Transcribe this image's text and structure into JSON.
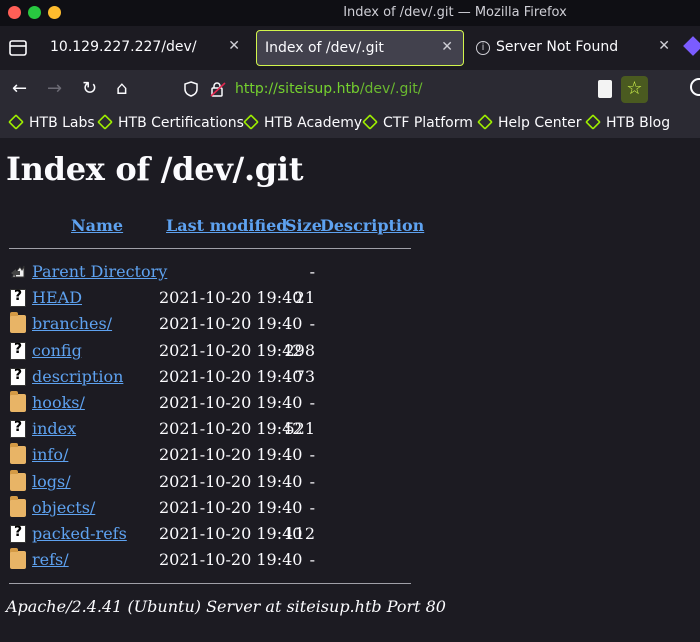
{
  "window": {
    "title": "Index of /dev/.git — Mozilla Firefox"
  },
  "tabs": [
    {
      "label": "10.129.227.227/dev/",
      "close": "✕"
    },
    {
      "label": "Index of /dev/.git",
      "close": "✕"
    },
    {
      "label": "Server Not Found",
      "close": "✕"
    }
  ],
  "navbar": {
    "back": "←",
    "forward": "→",
    "reload": "↻",
    "home": "⌂",
    "url_domain": "http://siteisup.htb",
    "url_path": "/dev/.git/",
    "bookmark_star": "☆"
  },
  "bookmarks": [
    "HTB Labs",
    "HTB Certifications",
    "HTB Academy",
    "CTF Platform",
    "Help Center",
    "HTB Blog"
  ],
  "page": {
    "heading": "Index of /dev/.git",
    "columns": {
      "name": "Name",
      "modified": "Last modified",
      "size": "Size",
      "description": "Description"
    },
    "rows": [
      {
        "icon": "back-icon",
        "name": "Parent Directory",
        "modified": "",
        "size": "-"
      },
      {
        "icon": "file-icon",
        "name": "HEAD",
        "modified": "2021-10-20 19:40",
        "size": "21"
      },
      {
        "icon": "folder-icon",
        "name": "branches/",
        "modified": "2021-10-20 19:40",
        "size": "-"
      },
      {
        "icon": "file-icon",
        "name": "config",
        "modified": "2021-10-20 19:42",
        "size": "298"
      },
      {
        "icon": "file-icon",
        "name": "description",
        "modified": "2021-10-20 19:40",
        "size": "73"
      },
      {
        "icon": "folder-icon",
        "name": "hooks/",
        "modified": "2021-10-20 19:40",
        "size": "-"
      },
      {
        "icon": "file-icon",
        "name": "index",
        "modified": "2021-10-20 19:42",
        "size": "521"
      },
      {
        "icon": "folder-icon",
        "name": "info/",
        "modified": "2021-10-20 19:40",
        "size": "-"
      },
      {
        "icon": "folder-icon",
        "name": "logs/",
        "modified": "2021-10-20 19:40",
        "size": "-"
      },
      {
        "icon": "folder-icon",
        "name": "objects/",
        "modified": "2021-10-20 19:40",
        "size": "-"
      },
      {
        "icon": "file-icon",
        "name": "packed-refs",
        "modified": "2021-10-20 19:40",
        "size": "112"
      },
      {
        "icon": "folder-icon",
        "name": "refs/",
        "modified": "2021-10-20 19:40",
        "size": "-"
      }
    ],
    "address": "Apache/2.4.41 (Ubuntu) Server at siteisup.htb Port 80"
  },
  "colors": {
    "link": "#5ea2f0",
    "url_green": "#75d12f",
    "active_tab_border": "#d2f54c",
    "htb_green": "#9fef00"
  }
}
